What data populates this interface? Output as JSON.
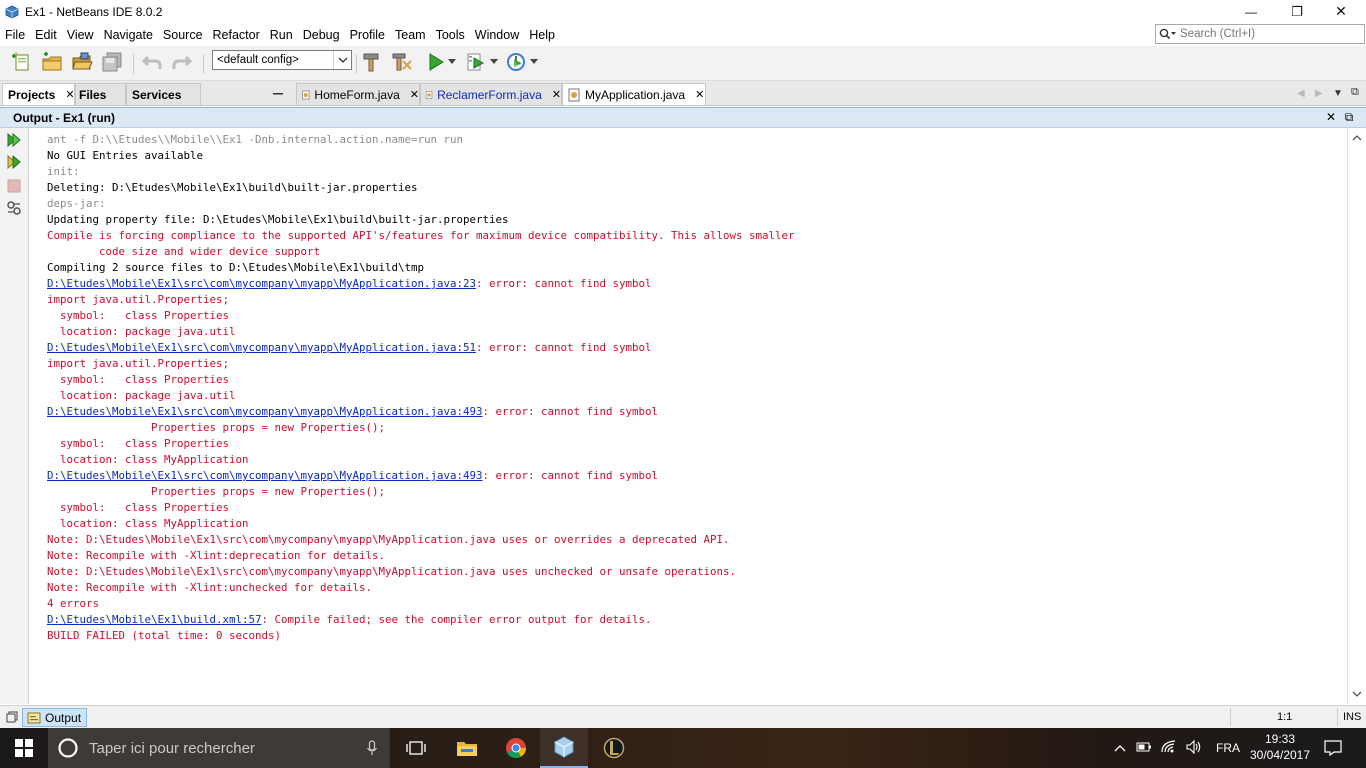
{
  "window": {
    "title": "Ex1 - NetBeans IDE 8.0.2",
    "controls": {
      "minimize": "—",
      "maximize": "❐",
      "close": "✕"
    }
  },
  "menu": [
    "File",
    "Edit",
    "View",
    "Navigate",
    "Source",
    "Refactor",
    "Run",
    "Debug",
    "Profile",
    "Team",
    "Tools",
    "Window",
    "Help"
  ],
  "search": {
    "placeholder": "Search (Ctrl+I)"
  },
  "toolbar": {
    "config_value": "<default config>"
  },
  "panel_tabs": [
    {
      "label": "Projects",
      "active": true,
      "closable": true
    },
    {
      "label": "Files",
      "active": false,
      "closable": false
    },
    {
      "label": "Services",
      "active": false,
      "closable": false
    }
  ],
  "editor_tabs": [
    {
      "label": "HomeForm.java",
      "active": false,
      "modified": false
    },
    {
      "label": "ReclamerForm.java",
      "active": false,
      "modified": true
    },
    {
      "label": "MyApplication.java",
      "active": true,
      "modified": false
    }
  ],
  "output": {
    "title": "Output - Ex1 (run)",
    "lines": [
      {
        "text": "ant -f D:\\\\Etudes\\\\Mobile\\\\Ex1 -Dnb.internal.action.name=run run",
        "kind": "gray"
      },
      {
        "text": "No GUI Entries available",
        "kind": "black"
      },
      {
        "text": "init:",
        "kind": "gray"
      },
      {
        "text": "Deleting: D:\\Etudes\\Mobile\\Ex1\\build\\built-jar.properties",
        "kind": "black"
      },
      {
        "text": "deps-jar:",
        "kind": "gray"
      },
      {
        "text": "Updating property file: D:\\Etudes\\Mobile\\Ex1\\build\\built-jar.properties",
        "kind": "black"
      },
      {
        "text": "Compile is forcing compliance to the supported API's/features for maximum device compatibility. This allows smaller",
        "kind": "red"
      },
      {
        "text": "        code size and wider device support",
        "kind": "red"
      },
      {
        "text": "Compiling 2 source files to D:\\Etudes\\Mobile\\Ex1\\build\\tmp",
        "kind": "black"
      },
      {
        "link": "D:\\Etudes\\Mobile\\Ex1\\src\\com\\mycompany\\myapp\\MyApplication.java:23",
        "text": ": error: cannot find symbol",
        "kind": "red"
      },
      {
        "text": "import java.util.Properties;",
        "kind": "red"
      },
      {
        "text": "  symbol:   class Properties",
        "kind": "red"
      },
      {
        "text": "  location: package java.util",
        "kind": "red"
      },
      {
        "link": "D:\\Etudes\\Mobile\\Ex1\\src\\com\\mycompany\\myapp\\MyApplication.java:51",
        "text": ": error: cannot find symbol",
        "kind": "red"
      },
      {
        "text": "import java.util.Properties;",
        "kind": "red"
      },
      {
        "text": "  symbol:   class Properties",
        "kind": "red"
      },
      {
        "text": "  location: package java.util",
        "kind": "red"
      },
      {
        "link": "D:\\Etudes\\Mobile\\Ex1\\src\\com\\mycompany\\myapp\\MyApplication.java:493",
        "text": ": error: cannot find symbol",
        "kind": "red"
      },
      {
        "text": "                Properties props = new Properties();",
        "kind": "red"
      },
      {
        "text": "  symbol:   class Properties",
        "kind": "red"
      },
      {
        "text": "  location: class MyApplication",
        "kind": "red"
      },
      {
        "link": "D:\\Etudes\\Mobile\\Ex1\\src\\com\\mycompany\\myapp\\MyApplication.java:493",
        "text": ": error: cannot find symbol",
        "kind": "red"
      },
      {
        "text": "                Properties props = new Properties();",
        "kind": "red"
      },
      {
        "text": "  symbol:   class Properties",
        "kind": "red"
      },
      {
        "text": "  location: class MyApplication",
        "kind": "red"
      },
      {
        "text": "Note: D:\\Etudes\\Mobile\\Ex1\\src\\com\\mycompany\\myapp\\MyApplication.java uses or overrides a deprecated API.",
        "kind": "red"
      },
      {
        "text": "Note: Recompile with -Xlint:deprecation for details.",
        "kind": "red"
      },
      {
        "text": "Note: D:\\Etudes\\Mobile\\Ex1\\src\\com\\mycompany\\myapp\\MyApplication.java uses unchecked or unsafe operations.",
        "kind": "red"
      },
      {
        "text": "Note: Recompile with -Xlint:unchecked for details.",
        "kind": "red"
      },
      {
        "text": "4 errors",
        "kind": "red"
      },
      {
        "link": "D:\\Etudes\\Mobile\\Ex1\\build.xml:57",
        "text": ": Compile failed; see the compiler error output for details.",
        "kind": "red"
      },
      {
        "text": "BUILD FAILED (total time: 0 seconds)",
        "kind": "red"
      }
    ]
  },
  "statusbar": {
    "output_label": "Output",
    "position": "1:1",
    "mode": "INS"
  },
  "taskbar": {
    "search_placeholder": "Taper ici pour rechercher",
    "language": "FRA",
    "time": "19:33",
    "date": "30/04/2017"
  },
  "colors": {
    "error": "#c8102e",
    "link": "#0b2bbf",
    "gray": "#8c8c8c",
    "accent": "#dde8f5"
  }
}
